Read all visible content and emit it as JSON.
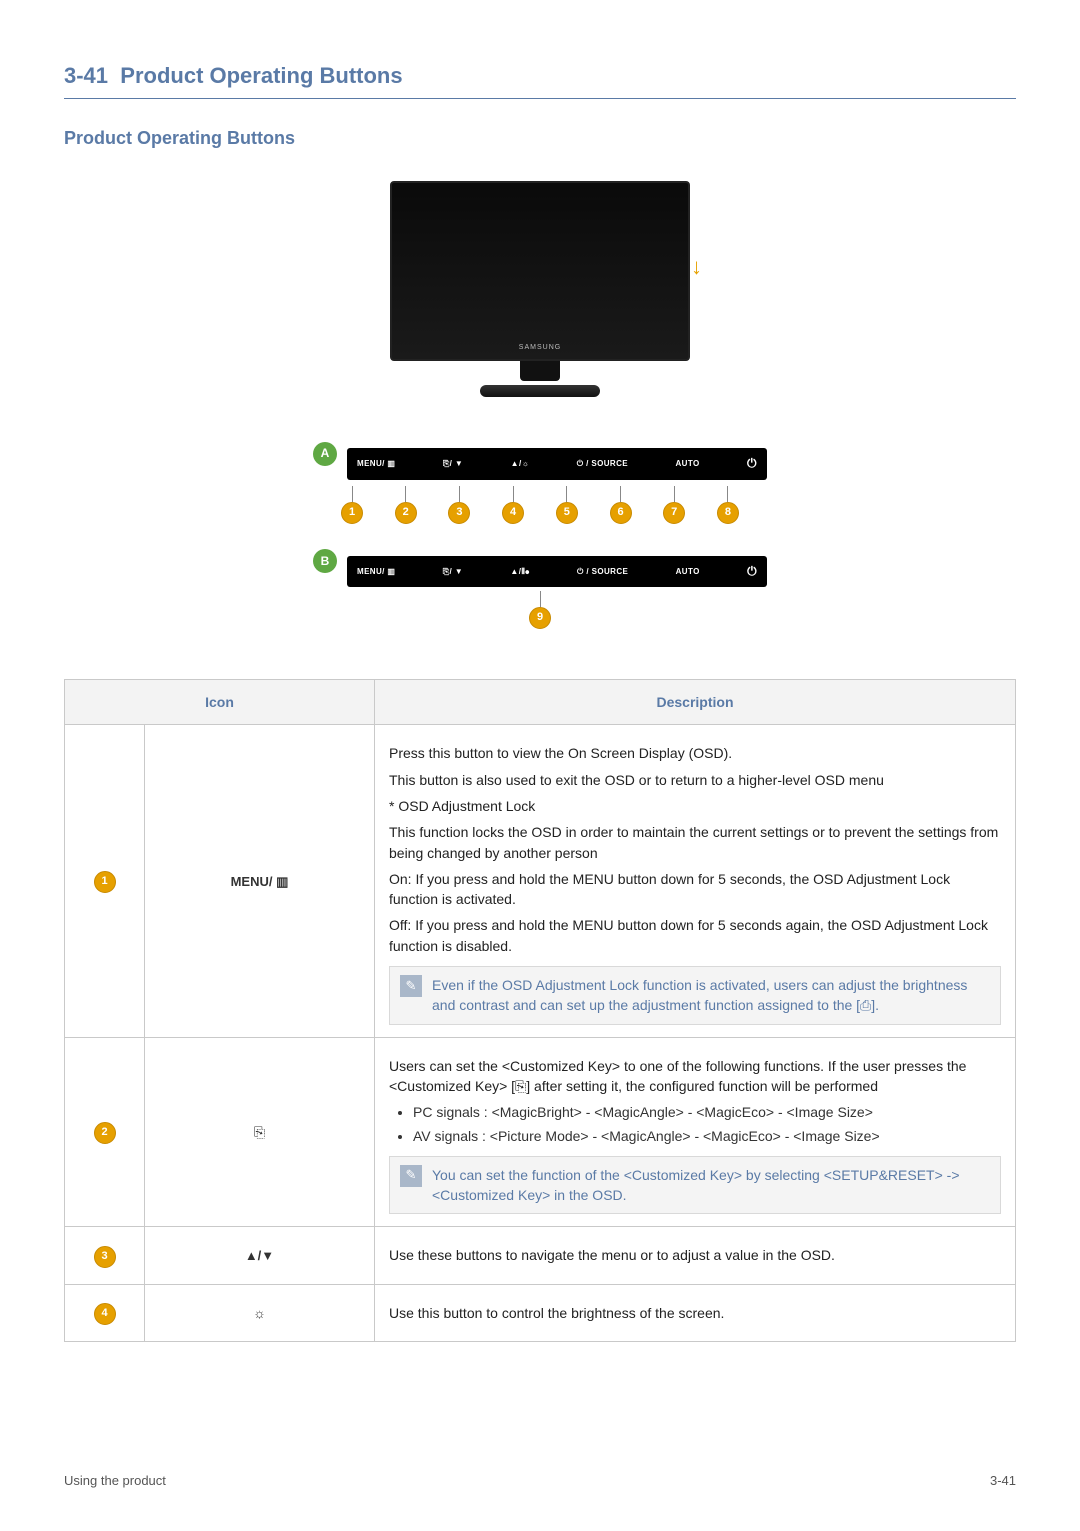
{
  "section": {
    "number": "3-41",
    "title": "Product Operating Buttons"
  },
  "subtitle": "Product Operating Buttons",
  "monitor": {
    "brand": "SAMSUNG"
  },
  "sideBadges": {
    "a": "A",
    "b": "B"
  },
  "barA": {
    "menu": "MENU/ ▥",
    "key2": "⎘/ ▼",
    "key3": "▲/☼",
    "key4": "⏻ / SOURCE",
    "auto": "AUTO",
    "power": "⏻"
  },
  "barB": {
    "menu": "MENU/ ▥",
    "key2": "⎘/ ▼",
    "key3": "▲/⦀⦁",
    "key4": "⏻ / SOURCE",
    "auto": "AUTO",
    "power": "⏻"
  },
  "callouts": [
    "1",
    "2",
    "3",
    "4",
    "5",
    "6",
    "7",
    "8"
  ],
  "callout9": "9",
  "tableHeaders": {
    "icon": "Icon",
    "desc": "Description"
  },
  "rows": {
    "r1": {
      "num": "1",
      "iconLabel": "MENU/ ▥",
      "p1": "Press this button to view the On Screen Display (OSD).",
      "p2": "This button is also used to exit the OSD or to return to a higher-level OSD menu",
      "p3": "* OSD Adjustment Lock",
      "p4": "This function locks the OSD in order to maintain the current settings or to prevent the settings from being changed by another person",
      "p5": "On: If you press and hold the MENU button down for 5 seconds, the OSD Adjustment Lock function is activated.",
      "p6": "Off: If you press and hold the MENU button down for 5 seconds again, the OSD Adjustment Lock function is disabled.",
      "note": "Even if the OSD Adjustment Lock function is activated, users can adjust the brightness and contrast and can set up the adjustment function assigned to the [⎙]."
    },
    "r2": {
      "num": "2",
      "iconLabel": "⎘",
      "p1": "Users can set the <Customized Key> to one of the following functions. If the user presses the <Customized Key> [⎘] after setting it, the configured function will be performed",
      "li1": "PC signals : <MagicBright> - <MagicAngle> - <MagicEco> - <Image Size>",
      "li2": "AV signals : <Picture Mode> - <MagicAngle> - <MagicEco> - <Image Size>",
      "note": "You can set the function of the <Customized Key> by selecting <SETUP&RESET> -> <Customized Key> in the OSD."
    },
    "r3": {
      "num": "3",
      "iconLabel": "▲/▼",
      "p1": "Use these buttons to navigate the menu or to adjust a value in the OSD."
    },
    "r4": {
      "num": "4",
      "iconLabel": "☼",
      "p1": "Use this button to control the brightness of the screen."
    }
  },
  "footer": {
    "left": "Using the product",
    "right": "3-41"
  }
}
